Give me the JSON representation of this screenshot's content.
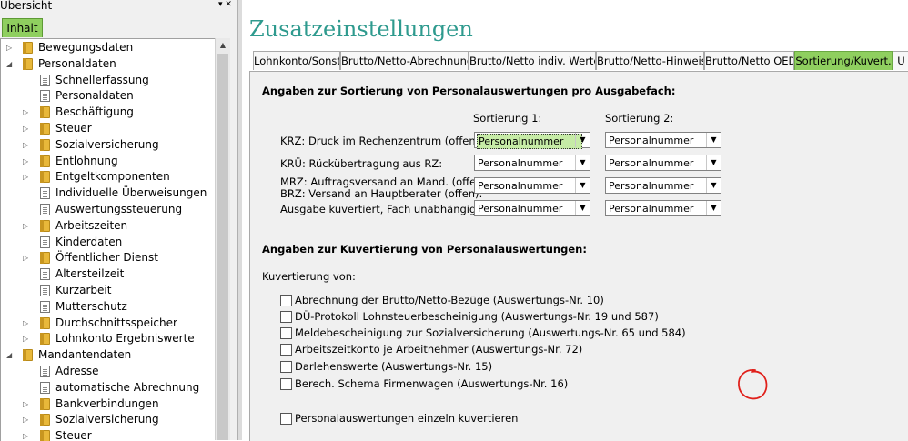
{
  "left_pane": {
    "title": "Übersicht",
    "pin_icon": "pin-icon",
    "close_icon": "close-icon",
    "tab": "Inhalt",
    "tree": [
      {
        "label": "Bewegungsdaten",
        "icon": "folder",
        "level": 0,
        "expander": "collapsed"
      },
      {
        "label": "Personaldaten",
        "icon": "folder",
        "level": 0,
        "expander": "expanded"
      },
      {
        "label": "Schnellerfassung",
        "icon": "doc",
        "level": 1,
        "expander": "none"
      },
      {
        "label": "Personaldaten",
        "icon": "doc",
        "level": 1,
        "expander": "none"
      },
      {
        "label": "Beschäftigung",
        "icon": "folder",
        "level": 1,
        "expander": "collapsed"
      },
      {
        "label": "Steuer",
        "icon": "folder",
        "level": 1,
        "expander": "collapsed"
      },
      {
        "label": "Sozialversicherung",
        "icon": "folder",
        "level": 1,
        "expander": "collapsed"
      },
      {
        "label": "Entlohnung",
        "icon": "folder",
        "level": 1,
        "expander": "collapsed"
      },
      {
        "label": "Entgeltkomponenten",
        "icon": "folder",
        "level": 1,
        "expander": "collapsed"
      },
      {
        "label": "Individuelle Überweisungen",
        "icon": "doc",
        "level": 1,
        "expander": "none"
      },
      {
        "label": "Auswertungssteuerung",
        "icon": "doc",
        "level": 1,
        "expander": "none"
      },
      {
        "label": "Arbeitszeiten",
        "icon": "folder",
        "level": 1,
        "expander": "collapsed"
      },
      {
        "label": "Kinderdaten",
        "icon": "doc",
        "level": 1,
        "expander": "none"
      },
      {
        "label": "Öffentlicher Dienst",
        "icon": "folder",
        "level": 1,
        "expander": "collapsed"
      },
      {
        "label": "Altersteilzeit",
        "icon": "doc",
        "level": 1,
        "expander": "none"
      },
      {
        "label": "Kurzarbeit",
        "icon": "doc",
        "level": 1,
        "expander": "none"
      },
      {
        "label": "Mutterschutz",
        "icon": "doc",
        "level": 1,
        "expander": "none"
      },
      {
        "label": "Durchschnittsspeicher",
        "icon": "folder",
        "level": 1,
        "expander": "collapsed"
      },
      {
        "label": "Lohnkonto Ergebniswerte",
        "icon": "folder",
        "level": 1,
        "expander": "collapsed"
      },
      {
        "label": "Mandantendaten",
        "icon": "folder",
        "level": 0,
        "expander": "expanded"
      },
      {
        "label": "Adresse",
        "icon": "doc",
        "level": 1,
        "expander": "none"
      },
      {
        "label": "automatische Abrechnung",
        "icon": "doc",
        "level": 1,
        "expander": "none"
      },
      {
        "label": "Bankverbindungen",
        "icon": "folder",
        "level": 1,
        "expander": "collapsed"
      },
      {
        "label": "Sozialversicherung",
        "icon": "folder",
        "level": 1,
        "expander": "collapsed"
      },
      {
        "label": "Steuer",
        "icon": "folder",
        "level": 1,
        "expander": "collapsed"
      }
    ]
  },
  "main": {
    "title": "Zusatzeinstellungen",
    "tabs": [
      {
        "label": "Lohnkonto/Sonst.",
        "active": false
      },
      {
        "label": "Brutto/Netto-Abrechnung",
        "active": false
      },
      {
        "label": "Brutto/Netto indiv. Werte",
        "active": false
      },
      {
        "label": "Brutto/Netto-Hinweis",
        "active": false
      },
      {
        "label": "Brutto/Netto OED",
        "active": false
      },
      {
        "label": "Sortierung/Kuvert.",
        "active": true
      },
      {
        "label": "U",
        "active": false
      }
    ],
    "sort_section": {
      "heading": "Angaben zur Sortierung von Personalauswertungen pro Ausgabefach:",
      "col1": "Sortierung 1:",
      "col2": "Sortierung 2:",
      "rows": [
        {
          "label": "KRZ: Druck im Rechenzentrum (offen):",
          "s1": "Personalnummer",
          "s2": "Personalnummer"
        },
        {
          "label": "KRÜ: Rückübertragung aus RZ:",
          "s1": "Personalnummer",
          "s2": "Personalnummer"
        },
        {
          "label": "MRZ: Auftragsversand an Mand. (offen)/",
          "label2": "BRZ: Versand an Hauptberater (offen):",
          "s1": "Personalnummer",
          "s2": "Personalnummer"
        },
        {
          "label": "Ausgabe kuvertiert, Fach unabhängig:",
          "s1": "Personalnummer",
          "s2": "Personalnummer"
        }
      ]
    },
    "kuvert_section": {
      "heading": "Angaben zur Kuvertierung von Personalauswertungen:",
      "sublabel": "Kuvertierung von:",
      "items": [
        {
          "label": "Abrechnung der Brutto/Netto-Bezüge (Auswertungs-Nr. 10)",
          "checked": false
        },
        {
          "label": "DÜ-Protokoll Lohnsteuerbescheinigung (Auswertungs-Nr. 19 und 587)",
          "checked": false
        },
        {
          "label": "Meldebescheinigung zur Sozialversicherung (Auswertungs-Nr. 65 und 584)",
          "checked": false
        },
        {
          "label": "Arbeitszeitkonto je Arbeitnehmer (Auswertungs-Nr. 72)",
          "checked": false
        },
        {
          "label": "Darlehenswerte (Auswertungs-Nr. 15)",
          "checked": false
        },
        {
          "label": "Berech. Schema Firmenwagen (Auswertungs-Nr. 16)",
          "checked": false
        }
      ],
      "extra": {
        "label": "Personalauswertungen einzeln kuvertieren",
        "checked": false
      }
    },
    "annotation_color": "#e0201b"
  }
}
